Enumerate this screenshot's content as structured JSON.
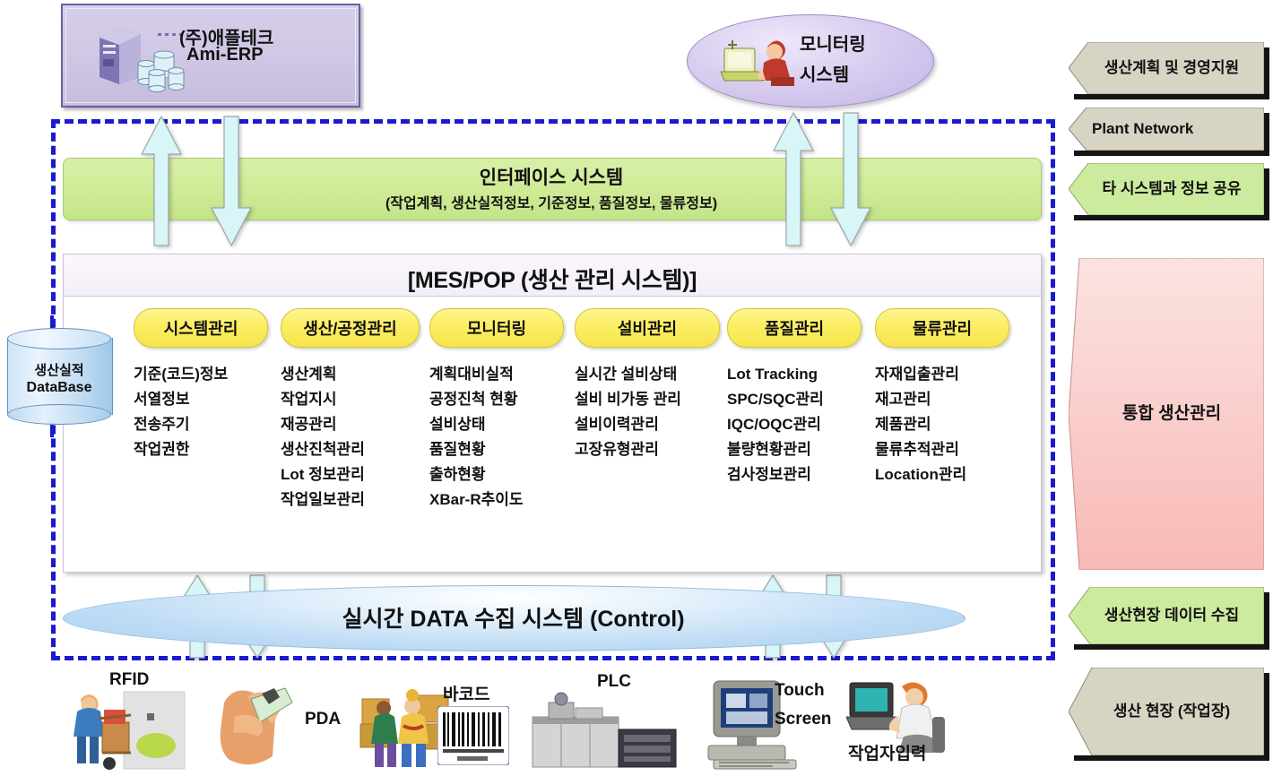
{
  "erp": {
    "company": "(주)애플테크",
    "product": "Ami-ERP",
    "server_icon": "server-icon",
    "disks_icon": "database-disks-icon"
  },
  "monitoring": {
    "line1": "모니터링",
    "line2": "시스템",
    "icon": "person-at-computer-icon"
  },
  "interface": {
    "title": "인터페이스 시스템",
    "subtitle": "(작업계획, 생산실적정보, 기준정보, 품질정보, 물류정보)"
  },
  "mes": {
    "title": "[MES/POP (생산 관리 시스템)]",
    "columns": [
      {
        "label": "시스템관리",
        "items": [
          "기준(코드)정보",
          "서열정보",
          "전송주기",
          "작업권한"
        ]
      },
      {
        "label": "생산/공정관리",
        "items": [
          "생산계획",
          "작업지시",
          "재공관리",
          "생산진척관리",
          "Lot 정보관리",
          "작업일보관리"
        ]
      },
      {
        "label": "모니터링",
        "items": [
          "계획대비실적",
          "공정진척 현황",
          "설비상태",
          "품질현황",
          "출하현황",
          "XBar-R추이도"
        ]
      },
      {
        "label": "설비관리",
        "items": [
          "실시간 설비상태",
          "설비 비가동 관리",
          "설비이력관리",
          "고장유형관리"
        ]
      },
      {
        "label": "품질관리",
        "items": [
          "Lot Tracking",
          "SPC/SQC관리",
          "IQC/OQC관리",
          "불량현황관리",
          "검사정보관리"
        ]
      },
      {
        "label": "물류관리",
        "items": [
          "자재입출관리",
          "재고관리",
          "제품관리",
          "물류추적관리",
          "Location관리"
        ]
      }
    ]
  },
  "database": {
    "line1": "생산실적",
    "line2": "DataBase"
  },
  "control": {
    "title": "실시간 DATA 수집 시스템 (Control)"
  },
  "right_panels": [
    {
      "label": "생산계획 및 경영지원",
      "color": "#d8d4c4"
    },
    {
      "label": "Plant Network",
      "color": "#d8d4c4"
    },
    {
      "label": "타 시스템과 정보 공유",
      "color": "#cdeb9e"
    },
    {
      "label": "통합 생산관리",
      "color": "#f9cfcf"
    },
    {
      "label": "생산현장 데이터 수집",
      "color": "#cdeb9e"
    },
    {
      "label": "생산 현장 (작업장)",
      "color": "#d8d4c4"
    }
  ],
  "devices": [
    {
      "label": "RFID",
      "icon": "worker-cart-rfid-icon"
    },
    {
      "label": "PDA",
      "icon": "hand-pda-icon"
    },
    {
      "label": "바코드",
      "icon": "barcode-workers-icon"
    },
    {
      "label": "PLC",
      "icon": "plc-machine-icon"
    },
    {
      "label": "Touch",
      "icon": "touch-screen-monitor-icon"
    },
    {
      "label": "Screen",
      "icon": "touch-screen-monitor-icon"
    },
    {
      "label": "작업자입력",
      "icon": "operator-terminal-icon"
    }
  ],
  "colors": {
    "frame": "#1a1ad0",
    "interface_band": "#cfeb96",
    "pill": "#fbee63",
    "arrow": "#d8f5f7"
  }
}
